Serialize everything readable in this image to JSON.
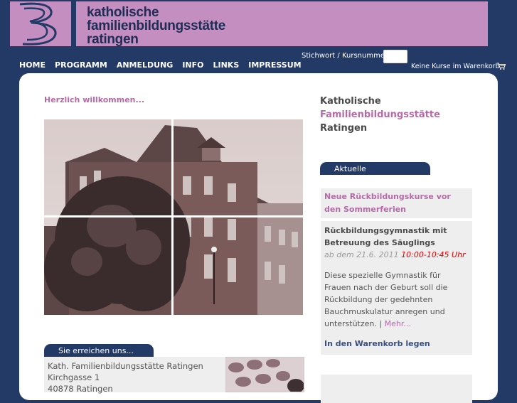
{
  "header": {
    "brand_line1": "katholische",
    "brand_line2": "familienbildungsstätte",
    "brand_line3": "ratingen",
    "brand_color": "#c58ec0",
    "nav_background": "#233a66"
  },
  "nav": {
    "items": [
      "HOME",
      "PROGRAMM",
      "ANMELDUNG",
      "INFO",
      "LINKS",
      "IMPRESSUM"
    ]
  },
  "search": {
    "label": "Stichwort / Kursnummer:",
    "value": ""
  },
  "cart": {
    "status": "Keine Kurse im Warenkorb",
    "icon": "cart-icon"
  },
  "main": {
    "welcome": "Herzlich willkommen..."
  },
  "contact": {
    "tab_label": "Sie erreichen uns...",
    "line1": "Kath. Familienbildungsstätte Ratingen",
    "line2": "Kirchgasse 1",
    "line3": "40878 Ratingen"
  },
  "sidebar": {
    "title_line1": "Katholische",
    "title_line2": "Familienbildungsstätte",
    "title_line3": "Ratingen",
    "info_tab_label": "Aktuelle Informationen...",
    "news_heading": "Neue Rückbildungskurse vor den Sommerferien",
    "course": {
      "title": "Rückbildungsgymnastik mit Betreuung des Säuglings",
      "date_prefix": "ab dem 21.6. 2011",
      "time": "10:00-10:45 Uhr",
      "description": "Diese spezielle Gymnastik für Frauen nach der Geburt soll die Rückbildung der gedehnten Bauchmuskulatur anregen und unterstützen. |",
      "more_link": "Mehr...",
      "cart_link": "In den Warenkorb legen"
    }
  }
}
